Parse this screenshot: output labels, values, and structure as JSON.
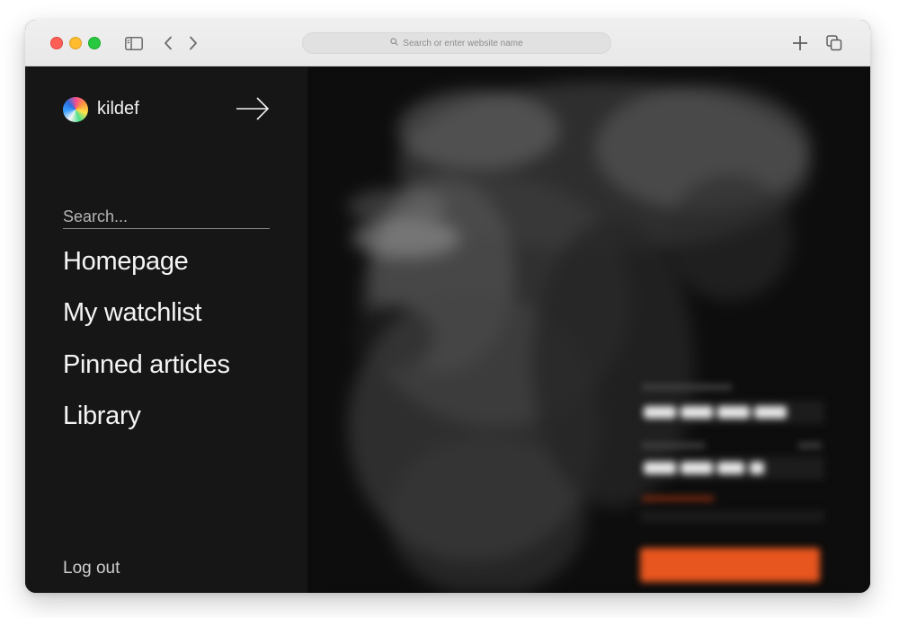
{
  "browser": {
    "url_placeholder": "Search or enter website name"
  },
  "sidebar": {
    "brand": "kildef",
    "search_placeholder": "Search...",
    "nav": [
      {
        "label": "Homepage"
      },
      {
        "label": "My watchlist"
      },
      {
        "label": "Pinned articles"
      },
      {
        "label": "Library"
      }
    ],
    "logout_label": "Log out"
  },
  "theme": {
    "sidebar_bg": "#161616",
    "accent": "#e8561f"
  },
  "icons": [
    "sidebar-toggle-icon",
    "chevron-left-icon",
    "chevron-right-icon",
    "search-icon",
    "plus-icon",
    "tabs-icon",
    "arrow-right-icon"
  ]
}
